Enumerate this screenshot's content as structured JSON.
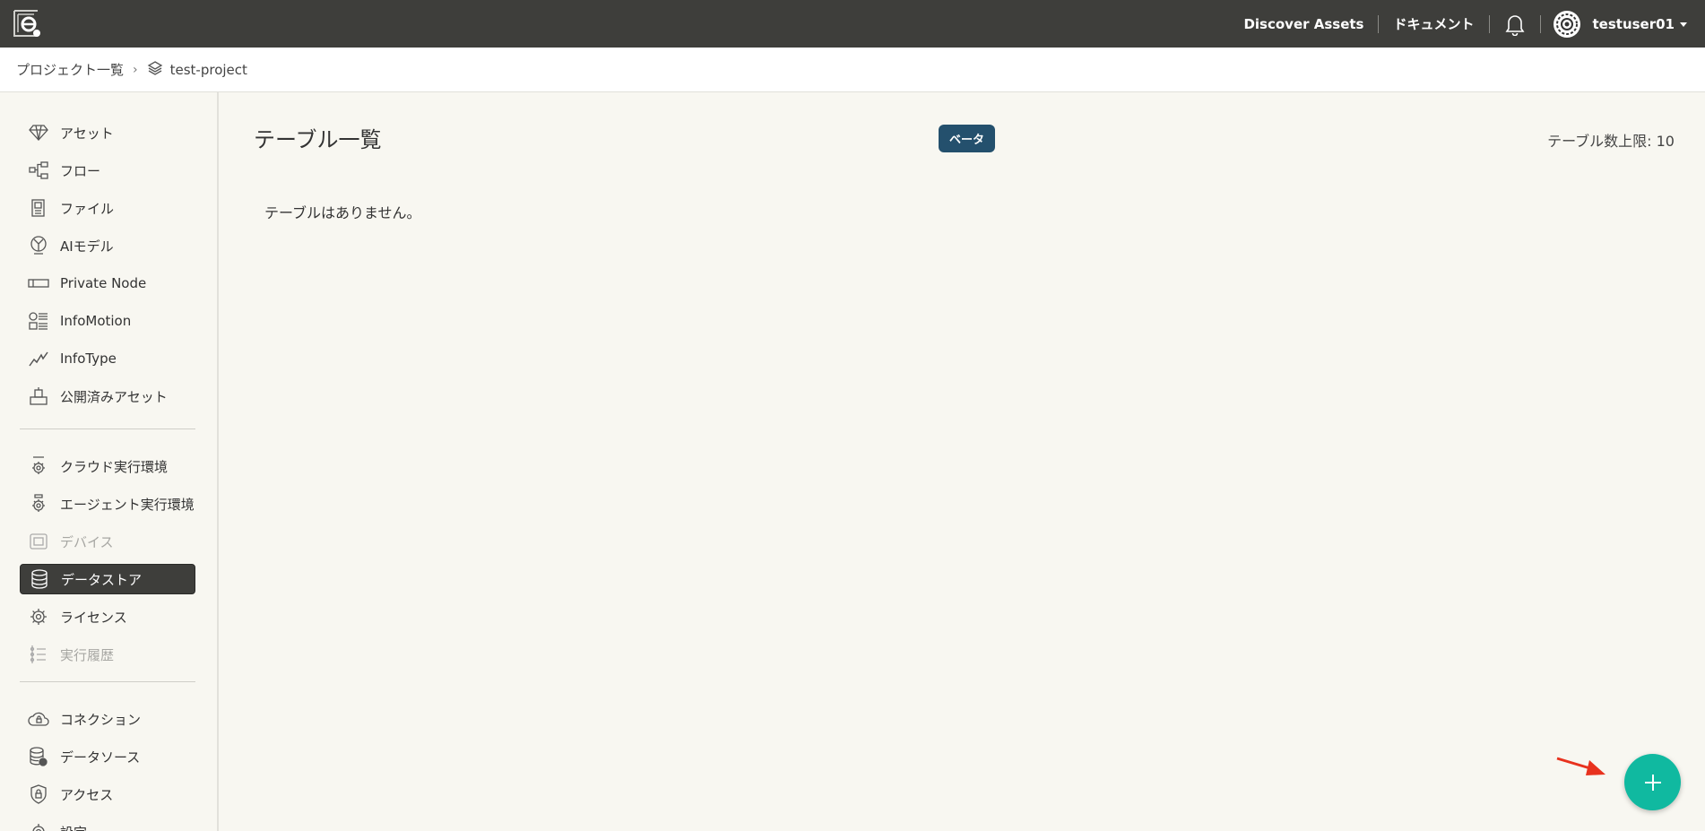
{
  "header": {
    "links": [
      "Discover Assets",
      "ドキュメント"
    ],
    "username": "testuser01"
  },
  "breadcrumb": {
    "root": "プロジェクト一覧",
    "separator": "›",
    "current": "test-project"
  },
  "sidebar": {
    "group1": [
      "アセット",
      "フロー",
      "ファイル",
      "AIモデル",
      "Private Node",
      "InfoMotion",
      "InfoType",
      "公開済みアセット"
    ],
    "group2": [
      "クラウド実行環境",
      "エージェント実行環境",
      "デバイス",
      "データストア",
      "ライセンス",
      "実行履歴"
    ],
    "group3": [
      "コネクション",
      "データソース",
      "アクセス",
      "設定"
    ],
    "active": "データストア",
    "disabled": [
      "デバイス",
      "実行履歴"
    ]
  },
  "main": {
    "title": "テーブル一覧",
    "badge": "ベータ",
    "limit_text": "テーブル数上限: 10",
    "empty_text": "テーブルはありません。"
  },
  "colors": {
    "topbar": "#3e3e3b",
    "badge": "#24506d",
    "fab": "#10b9a0",
    "arrow": "#e8321e"
  },
  "icons": {
    "fab": "plus-icon",
    "notification": "bell-icon"
  }
}
